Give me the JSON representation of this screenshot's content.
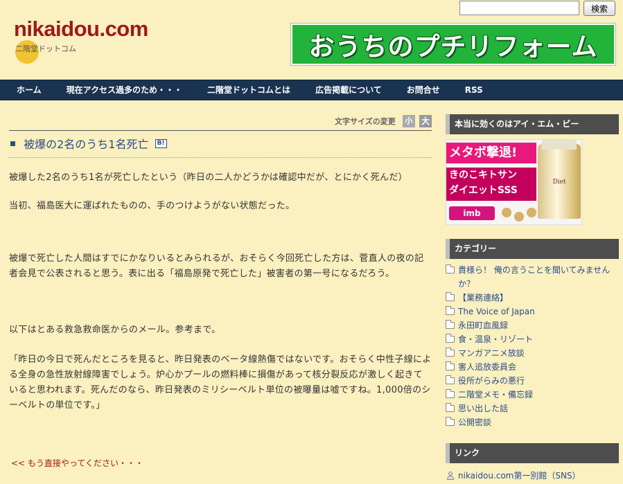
{
  "header": {
    "logo_text": "nikaidou.com",
    "logo_sub": "二階堂ドットコム",
    "banner_text": "おうちのプチリフォーム"
  },
  "search": {
    "placeholder": "",
    "button_label": "検索"
  },
  "nav": {
    "items": [
      {
        "label": "ホーム"
      },
      {
        "label": "現在アクセス過多のため・・・"
      },
      {
        "label": "二階堂ドットコムとは"
      },
      {
        "label": "広告掲載について"
      },
      {
        "label": "お問合せ"
      },
      {
        "label": "RSS"
      }
    ]
  },
  "main": {
    "font_size_label": "文字サイズの変更",
    "font_small": "小",
    "font_big": "大",
    "post_title": "被爆の2名のうち1名死亡",
    "hatena_icon": "B!",
    "paragraphs": [
      "被爆した2名のうち1名が死亡したという（昨日の二人かどうかは確認中だが、とにかく死んだ）",
      "当初、福島医大に運ばれたものの、手のつけようがない状態だった。",
      "被爆で死亡した人間はすでにかなりいるとみられるが、おそらく今回死亡した方は、菅直人の夜の記者会見で公表されると思う。表に出る「福島原発で死亡した」被害者の第一号になるだろう。",
      "以下はとある救急救命医からのメール。参考まで。",
      "「昨日の今日で死んだところを見ると、昨日発表のベータ線熱傷ではないです。おそらく中性子線による全身の急性放射線障害でしょう。炉心かプールの燃料棒に損傷があって核分裂反応が激しく起きていると思われます。死んだのなら、昨日発表のミリシーベルト単位の被曝量は嘘ですね。1,000倍のシーベルトの単位です。」"
    ],
    "prev_link": "<< もう直接やってください・・・"
  },
  "sidebar": {
    "ad_heading": "本当に効くのはアイ・エム・ビー",
    "ad": {
      "line1": "メタボ撃退!",
      "line2": "きのこキトサン",
      "line3": "ダイエットSSS",
      "brand": "imb",
      "bottle_label": "Diet"
    },
    "category_heading": "カテゴリー",
    "categories": [
      "貴様ら！ 俺の言うことを聞いてみませんか？",
      "【業務連絡】",
      "The Voice of Japan",
      "永田町血風録",
      "食・温泉・リゾート",
      "マンガアニメ放談",
      "害人追放委員会",
      "役所がらみの悪行",
      "二階堂メモ・備忘録",
      "思い出した話",
      "公開密談"
    ],
    "link_heading": "リンク",
    "link_item": "nikaidou.com第一別館（SNS）"
  },
  "colors": {
    "background": "#faf0c0",
    "nav_bg": "#1a3350",
    "logo_red": "#a01818",
    "title_blue": "#2a4d8a",
    "banner_green": "#22b33a"
  }
}
